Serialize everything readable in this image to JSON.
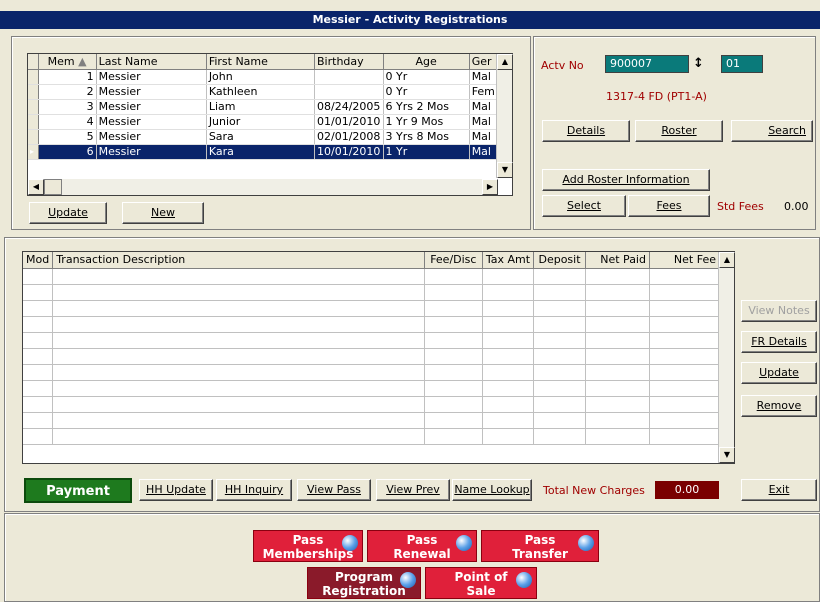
{
  "window": {
    "title": "Messier - Activity Registrations"
  },
  "members": {
    "columns": [
      "Mem",
      "Last Name",
      "First Name",
      "Birthday",
      "Age",
      "Ger"
    ],
    "rows": [
      {
        "mem": "1",
        "last": "Messier",
        "first": "John",
        "birthday": "",
        "age": "0 Yr",
        "gender": "Mal"
      },
      {
        "mem": "2",
        "last": "Messier",
        "first": "Kathleen",
        "birthday": "",
        "age": "0 Yr",
        "gender": "Fem"
      },
      {
        "mem": "3",
        "last": "Messier",
        "first": "Liam",
        "birthday": "08/24/2005",
        "age": "6 Yrs 2 Mos",
        "gender": "Mal"
      },
      {
        "mem": "4",
        "last": "Messier",
        "first": "Junior",
        "birthday": "01/01/2010",
        "age": "1 Yr 9 Mos",
        "gender": "Mal"
      },
      {
        "mem": "5",
        "last": "Messier",
        "first": "Sara",
        "birthday": "02/01/2008",
        "age": "3 Yrs 8 Mos",
        "gender": "Mal"
      },
      {
        "mem": "6",
        "last": "Messier",
        "first": "Kara",
        "birthday": "10/01/2010",
        "age": "1 Yr",
        "gender": "Mal"
      }
    ],
    "selected_row": 5,
    "update_label": "Update",
    "new_label": "New"
  },
  "activity": {
    "actv_no_label": "Actv No",
    "actv_no": "900007",
    "section": "01",
    "description": "1317-4 FD (PT1-A)",
    "details_label": "Details",
    "roster_label": "Roster",
    "search_label": "Search",
    "add_roster_label": "Add Roster Information",
    "select_label": "Select",
    "fees_label": "Fees",
    "std_fees_label": "Std Fees",
    "std_fees_value": "0.00"
  },
  "transactions": {
    "columns": [
      "Mod",
      "Transaction Description",
      "Fee/Disc",
      "Tax Amt",
      "Deposit",
      "Net Paid",
      "Net Fee"
    ],
    "rows": []
  },
  "side_buttons": {
    "view_notes": "View Notes",
    "fr_details": "FR Details",
    "update": "Update",
    "remove": "Remove"
  },
  "footer": {
    "payment": "Payment",
    "hh_update": "HH Update",
    "hh_inquiry": "HH Inquiry",
    "view_pass": "View Pass",
    "view_prev": "View Prev",
    "name_lookup": "Name Lookup",
    "total_label": "Total New Charges",
    "total_value": "0.00",
    "exit": "Exit"
  },
  "launcher": {
    "pass_memberships": [
      "Pass",
      "Memberships"
    ],
    "pass_renewal": [
      "Pass",
      "Renewal"
    ],
    "pass_transfer": [
      "Pass",
      "Transfer"
    ],
    "program_registration": [
      "Program",
      "Registration"
    ],
    "point_of_sale": [
      "Point of",
      "Sale"
    ]
  },
  "colors": {
    "title_bar": "#0a246a",
    "payment": "#1e7a1e",
    "launcher": "#e0203a",
    "total": "#7a0000"
  }
}
